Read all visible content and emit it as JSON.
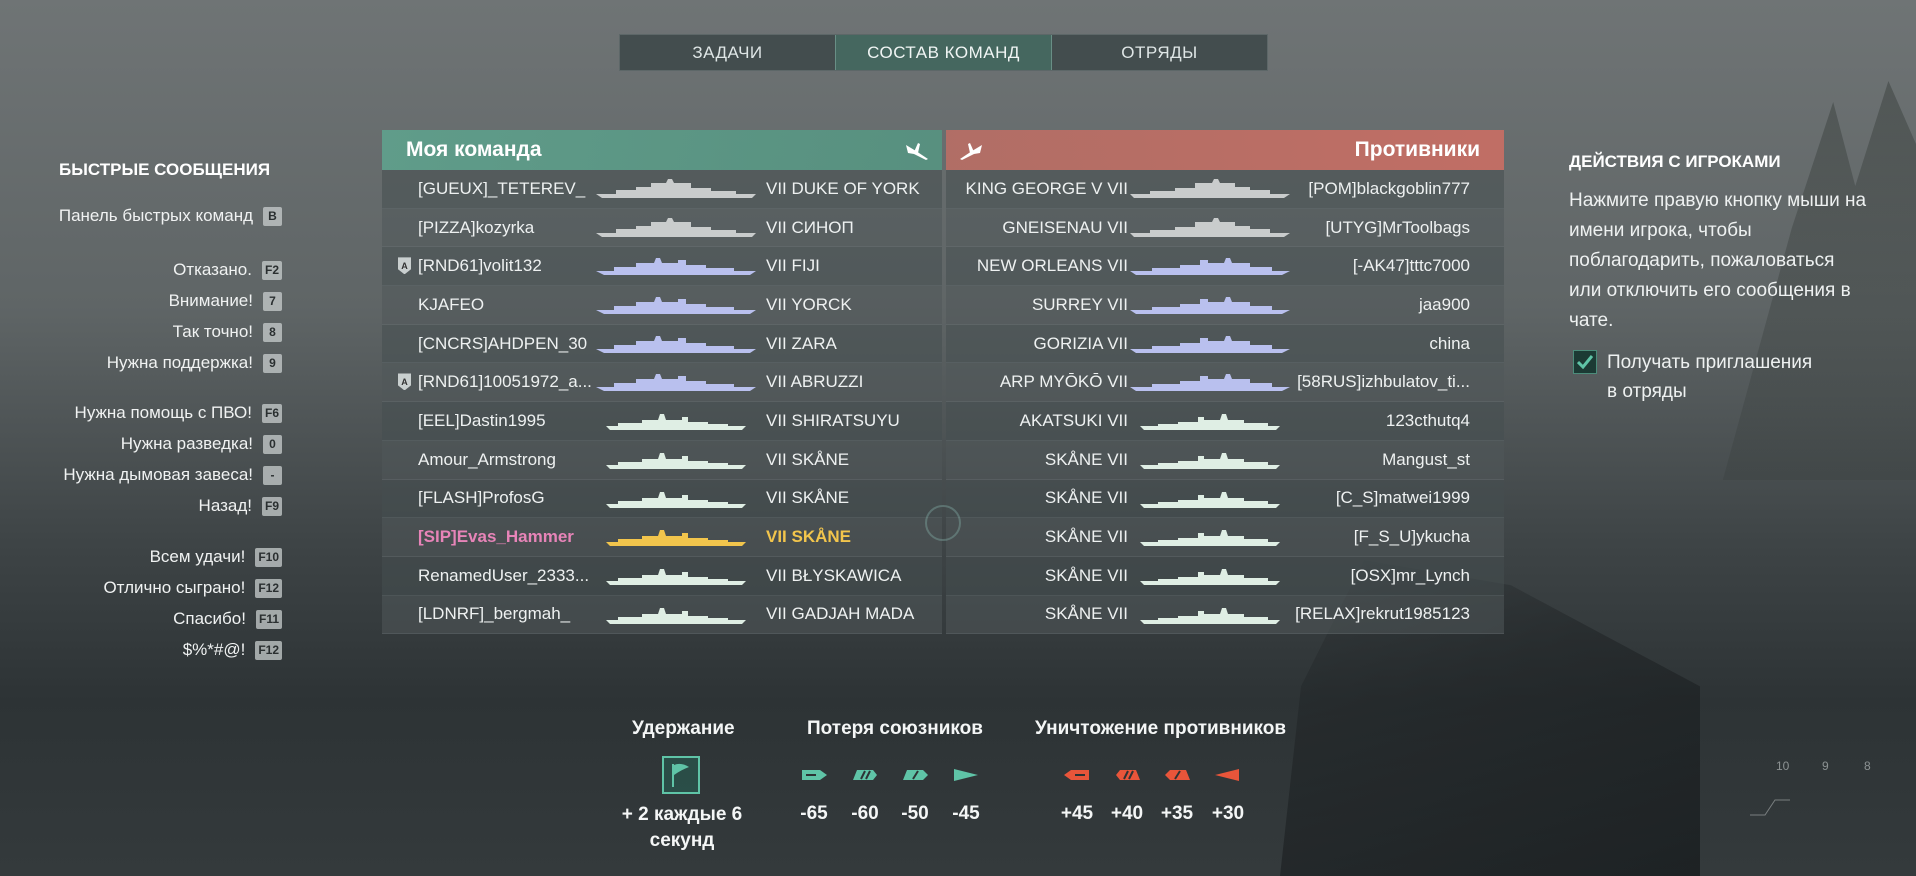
{
  "tabs": [
    {
      "label": "ЗАДАЧИ",
      "active": false
    },
    {
      "label": "СОСТАВ КОМАНД",
      "active": true
    },
    {
      "label": "ОТРЯДЫ",
      "active": false
    }
  ],
  "quick_messages": {
    "title": "БЫСТРЫЕ СООБЩЕНИЯ",
    "items": [
      {
        "label": "Панель быстрых команд",
        "key": "B"
      },
      {
        "label": "Отказано.",
        "key": "F2"
      },
      {
        "label": "Внимание!",
        "key": "7"
      },
      {
        "label": "Так точно!",
        "key": "8"
      },
      {
        "label": "Нужна поддержка!",
        "key": "9"
      },
      {
        "label": "Нужна помощь с ПВО!",
        "key": "F6"
      },
      {
        "label": "Нужна разведка!",
        "key": "0"
      },
      {
        "label": "Нужна дымовая завеса!",
        "key": "-"
      },
      {
        "label": "Назад!",
        "key": "F9"
      },
      {
        "label": "Всем удачи!",
        "key": "F10"
      },
      {
        "label": "Отлично сыграно!",
        "key": "F12"
      },
      {
        "label": "Спасибо!",
        "key": "F11"
      },
      {
        "label": "$%*#@!",
        "key": "F12"
      }
    ]
  },
  "my_team": {
    "title": "Моя команда",
    "rows": [
      {
        "player": "[GUEUX]_TETEREV_",
        "ship": "VII DUKE OF YORK",
        "class": "battleship",
        "division": ""
      },
      {
        "player": "[PIZZA]kozyrka",
        "ship": "VII СИНОП",
        "class": "battleship",
        "division": ""
      },
      {
        "player": "[RND61]volit132",
        "ship": "VII FIJI",
        "class": "cruiser",
        "division": "A"
      },
      {
        "player": "KJAFEO",
        "ship": "VII YORCK",
        "class": "cruiser",
        "division": ""
      },
      {
        "player": "[CNCRS]AHDPEN_30",
        "ship": "VII ZARA",
        "class": "cruiser",
        "division": ""
      },
      {
        "player": "[RND61]10051972_a...",
        "ship": "VII ABRUZZI",
        "class": "cruiser",
        "division": "A"
      },
      {
        "player": "[EEL]Dastin1995",
        "ship": "VII SHIRATSUYU",
        "class": "destroyer",
        "division": ""
      },
      {
        "player": "Amour_Armstrong",
        "ship": "VII SKÅNE",
        "class": "destroyer",
        "division": ""
      },
      {
        "player": "[FLASH]ProfosG",
        "ship": "VII SKÅNE",
        "class": "destroyer",
        "division": ""
      },
      {
        "player": "[SIP]Evas_Hammer",
        "ship": "VII SKÅNE",
        "class": "destroyer",
        "division": "",
        "me": true
      },
      {
        "player": "RenamedUser_2333...",
        "ship": "VII BŁYSKAWICA",
        "class": "destroyer",
        "division": ""
      },
      {
        "player": "[LDNRF]_bergmah_",
        "ship": "VII GADJAH MADA",
        "class": "destroyer",
        "division": ""
      }
    ]
  },
  "enemy_team": {
    "title": "Противники",
    "rows": [
      {
        "ship": "KING GEORGE V VII",
        "player": "[POM]blackgoblin777",
        "class": "battleship"
      },
      {
        "ship": "GNEISENAU VII",
        "player": "[UTYG]MrToolbags",
        "class": "battleship"
      },
      {
        "ship": "NEW ORLEANS VII",
        "player": "[-AK47]tttc7000",
        "class": "cruiser"
      },
      {
        "ship": "SURREY VII",
        "player": "jaa900",
        "class": "cruiser"
      },
      {
        "ship": "GORIZIA VII",
        "player": "china",
        "class": "cruiser"
      },
      {
        "ship": "ARP MYŌKŌ VII",
        "player": "[58RUS]izhbulatov_ti...",
        "class": "cruiser"
      },
      {
        "ship": "AKATSUKI VII",
        "player": "123cthutq4",
        "class": "destroyer"
      },
      {
        "ship": "SKÅNE VII",
        "player": "Mangust_st",
        "class": "destroyer"
      },
      {
        "ship": "SKÅNE VII",
        "player": "[C_S]matwei1999",
        "class": "destroyer"
      },
      {
        "ship": "SKÅNE VII",
        "player": "[F_S_U]ykucha",
        "class": "destroyer"
      },
      {
        "ship": "SKÅNE VII",
        "player": "[OSX]mr_Lynch",
        "class": "destroyer"
      },
      {
        "ship": "SKÅNE VII",
        "player": "[RELAX]rekrut1985123",
        "class": "destroyer"
      }
    ]
  },
  "player_actions": {
    "title": "ДЕЙСТВИЯ С ИГРОКАМИ",
    "text": "Нажмите правую кнопку мыши на имени игрока, чтобы поблагодарить, пожаловаться или отключить его сообщения в чате.",
    "checkbox_label": "Получать приглашения в отряды",
    "checked": true
  },
  "scoring": {
    "hold_title": "Удержание",
    "hold_text": "+ 2 каждые 6 секунд",
    "ally_loss_title": "Потеря союзников",
    "ally_loss_values": [
      "-65",
      "-60",
      "-50",
      "-45"
    ],
    "enemy_kill_title": "Уничтожение противников",
    "enemy_kill_values": [
      "+45",
      "+40",
      "+35",
      "+30"
    ]
  },
  "minimap_labels": [
    "10",
    "9",
    "8"
  ],
  "colors": {
    "ally": "#5fc4a7",
    "enemy": "#e8553a",
    "self_name": "#e784b8",
    "self_ship": "#f2c54c",
    "battleship": "#c9cccc",
    "cruiser": "#b9c0ee",
    "destroyer": "#dfeee4"
  }
}
